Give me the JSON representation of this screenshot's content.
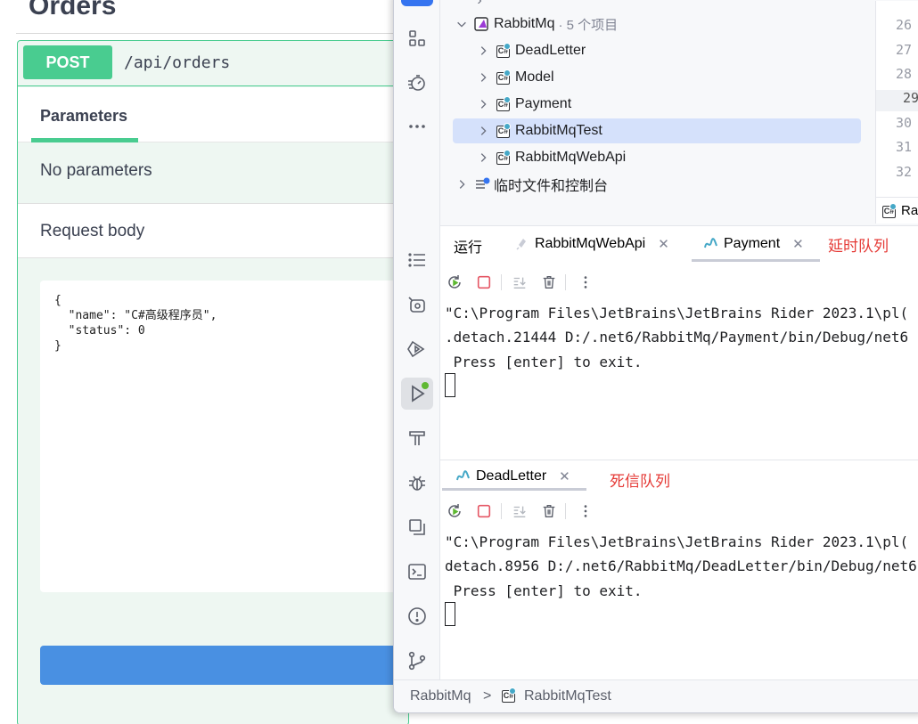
{
  "swagger": {
    "section_title": "Orders",
    "operation": {
      "method": "POST",
      "path": "/api/orders",
      "tab_parameters": "Parameters",
      "no_parameters": "No parameters",
      "request_body_label": "Request body",
      "request_body": "{\n  \"name\": \"C#高级程序员\",\n  \"status\": 0\n}"
    }
  },
  "rider": {
    "tree": {
      "solution": {
        "name": "RabbitMq",
        "count": "· 5 个项目"
      },
      "projects": [
        "DeadLetter",
        "Model",
        "Payment",
        "RabbitMqTest",
        "RabbitMqWebApi"
      ],
      "selected_project": "RabbitMqTest",
      "scratches": "临时文件和控制台"
    },
    "line_numbers": [
      "26",
      "27",
      "28",
      "29",
      "30",
      "31",
      "32"
    ],
    "current_line": "29",
    "editor_tab_partial": "Ra",
    "run": {
      "title": "运行",
      "tabs": [
        {
          "label": "RabbitMqWebApi",
          "active": false
        },
        {
          "label": "Payment",
          "active": true
        }
      ],
      "annotation_top": "延时队列",
      "console_top": [
        "\"C:\\Program Files\\JetBrains\\JetBrains Rider 2023.1\\pl(",
        ".detach.21444 D:/.net6/RabbitMq/Payment/bin/Debug/net6",
        " Press [enter] to exit."
      ],
      "bottom_tab": "DeadLetter",
      "annotation_bottom": "死信队列",
      "console_bottom": [
        "\"C:\\Program Files\\JetBrains\\JetBrains Rider 2023.1\\pl(",
        "detach.8956 D:/.net6/RabbitMq/DeadLetter/bin/Debug/net6",
        " Press [enter] to exit."
      ]
    },
    "statusbar": {
      "breadcrumb_root": "RabbitMq",
      "breadcrumb_separator": ">",
      "breadcrumb_project": "RabbitMqTest"
    },
    "colors": {
      "accent": "#3574f0",
      "swagger_post": "#49cc90",
      "annotation": "#e53935"
    }
  }
}
